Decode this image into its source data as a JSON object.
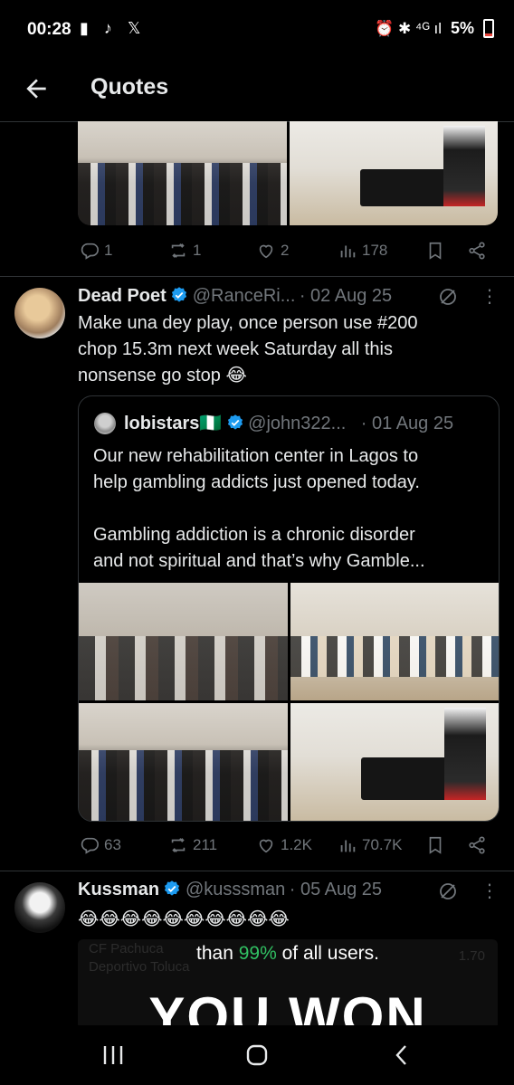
{
  "status_bar": {
    "time": "00:28",
    "left_icons": "▮ ♪ 𝕏",
    "right_icons": "⏰ ✱ ⁴ᴳ ıl",
    "battery": "5%"
  },
  "header": {
    "title": "Quotes"
  },
  "top_post": {
    "actions": {
      "replies": "1",
      "reposts": "1",
      "likes": "2",
      "views": "178"
    }
  },
  "post": {
    "author_name": "Dead Poet",
    "handle": "@RanceRi...",
    "date": "· 02 Aug 25",
    "text_line1": "Make una dey play, once person use #200",
    "text_line2": "chop 15.3m next week Saturday all this",
    "text_line3": "nonsense go stop 😂",
    "quoted": {
      "author_name": "lobistars🇳🇬",
      "handle": "@john322...",
      "date": "· 01 Aug 25",
      "line1": "Our new rehabilitation center in Lagos to",
      "line2": "help gambling addicts just opened today.",
      "line3": "Gambling addiction is a chronic disorder",
      "line4": "and not spiritual and that’s why Gamble..."
    },
    "actions": {
      "replies": "63",
      "reposts": "211",
      "likes": "1.2K",
      "views": "70.7K"
    }
  },
  "post2": {
    "author_name": "Kussman",
    "handle": "@kusssman",
    "date": "· 05 Aug 25",
    "text": "😂😂😂😂😂😂😂😂😂😂"
  },
  "promo": {
    "faded_left": "CF Pachuca",
    "faded_left2": "Deportivo Toluca",
    "faded_right": "1.70",
    "text_prefix": "than ",
    "percent": "99%",
    "text_suffix": " of all users.",
    "big": "YOU WON"
  },
  "colors": {
    "accent": "#1d9bf0",
    "muted": "#71767b",
    "promo_green": "#31c163"
  }
}
